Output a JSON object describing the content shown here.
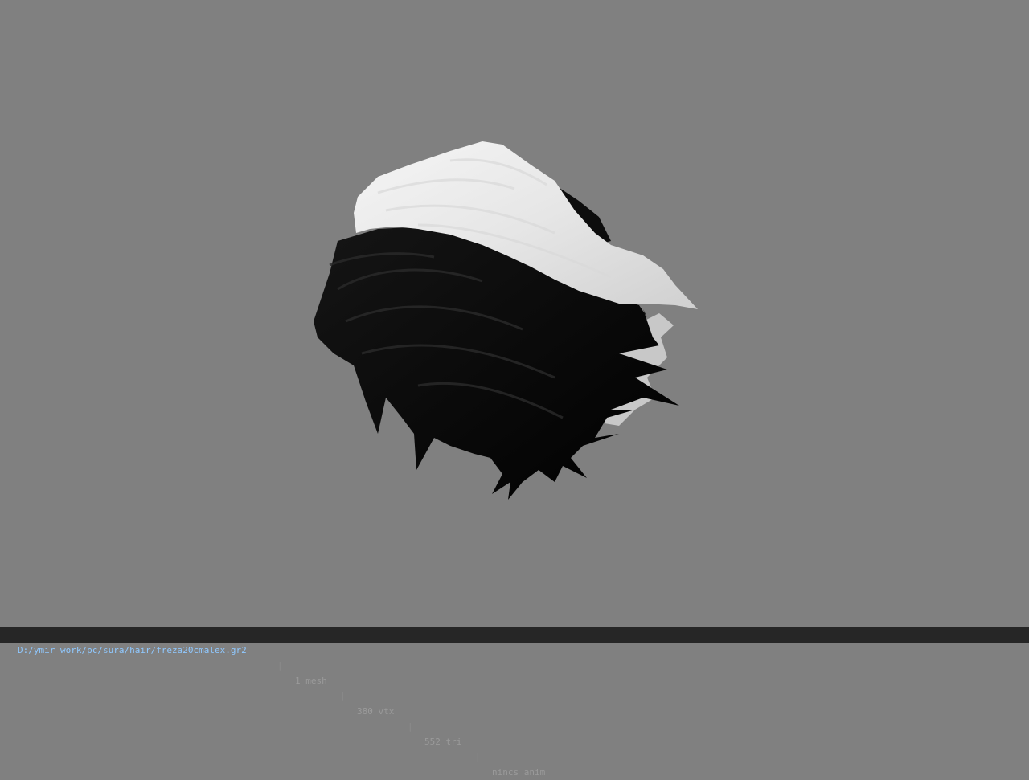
{
  "viewer": {
    "background_color": "#808080",
    "model": {
      "name": "hair mesh",
      "colors": {
        "light": "#e8e8e8",
        "dark": "#0a0a0a",
        "shade": "#bfbfbf"
      }
    }
  },
  "status": {
    "path": "D:/ymir work/pc/sura/hair/freza20cmalex.gr2",
    "separator": "|",
    "mesh": "1 mesh",
    "vtx": "380 vtx",
    "tri": "552 tri",
    "anim": "nincs anim"
  }
}
